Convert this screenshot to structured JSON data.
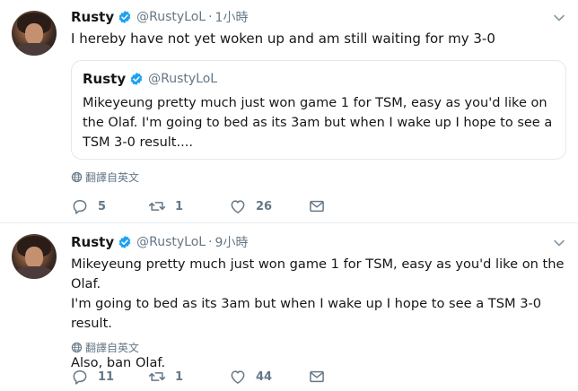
{
  "tweets": [
    {
      "name": "Rusty",
      "handle": "@RustyLoL",
      "dot": "·",
      "time": "1小時",
      "text": "I hereby have not yet woken up and am still waiting for my 3-0",
      "quote": {
        "name": "Rusty",
        "handle": "@RustyLoL",
        "text": "Mikeyeung pretty much just won game 1 for TSM, easy as you'd like on the Olaf. I'm going to bed as its 3am but when I wake up I hope to see a TSM 3-0 result...."
      },
      "translate": "翻譯自英文",
      "replies": "5",
      "retweets": "1",
      "likes": "26"
    },
    {
      "name": "Rusty",
      "handle": "@RustyLoL",
      "dot": "·",
      "time": "9小時",
      "text": "Mikeyeung pretty much just won game 1 for TSM, easy as you'd like on the Olaf.\nI'm going to bed as its 3am but when I wake up I hope to see a TSM 3-0 result.\n\nAlso, ban Olaf.",
      "translate": "翻譯自英文",
      "replies": "11",
      "retweets": "1",
      "likes": "44"
    }
  ],
  "icons": {
    "verified": "verified-badge-icon",
    "caret": "chevron-down-icon",
    "globe": "globe-icon",
    "reply": "reply-icon",
    "retweet": "retweet-icon",
    "like": "heart-icon",
    "message": "envelope-icon"
  },
  "colors": {
    "verified": "#1da1f2",
    "text": "#14171a",
    "secondary": "#657786",
    "border": "#e1e8ed"
  }
}
